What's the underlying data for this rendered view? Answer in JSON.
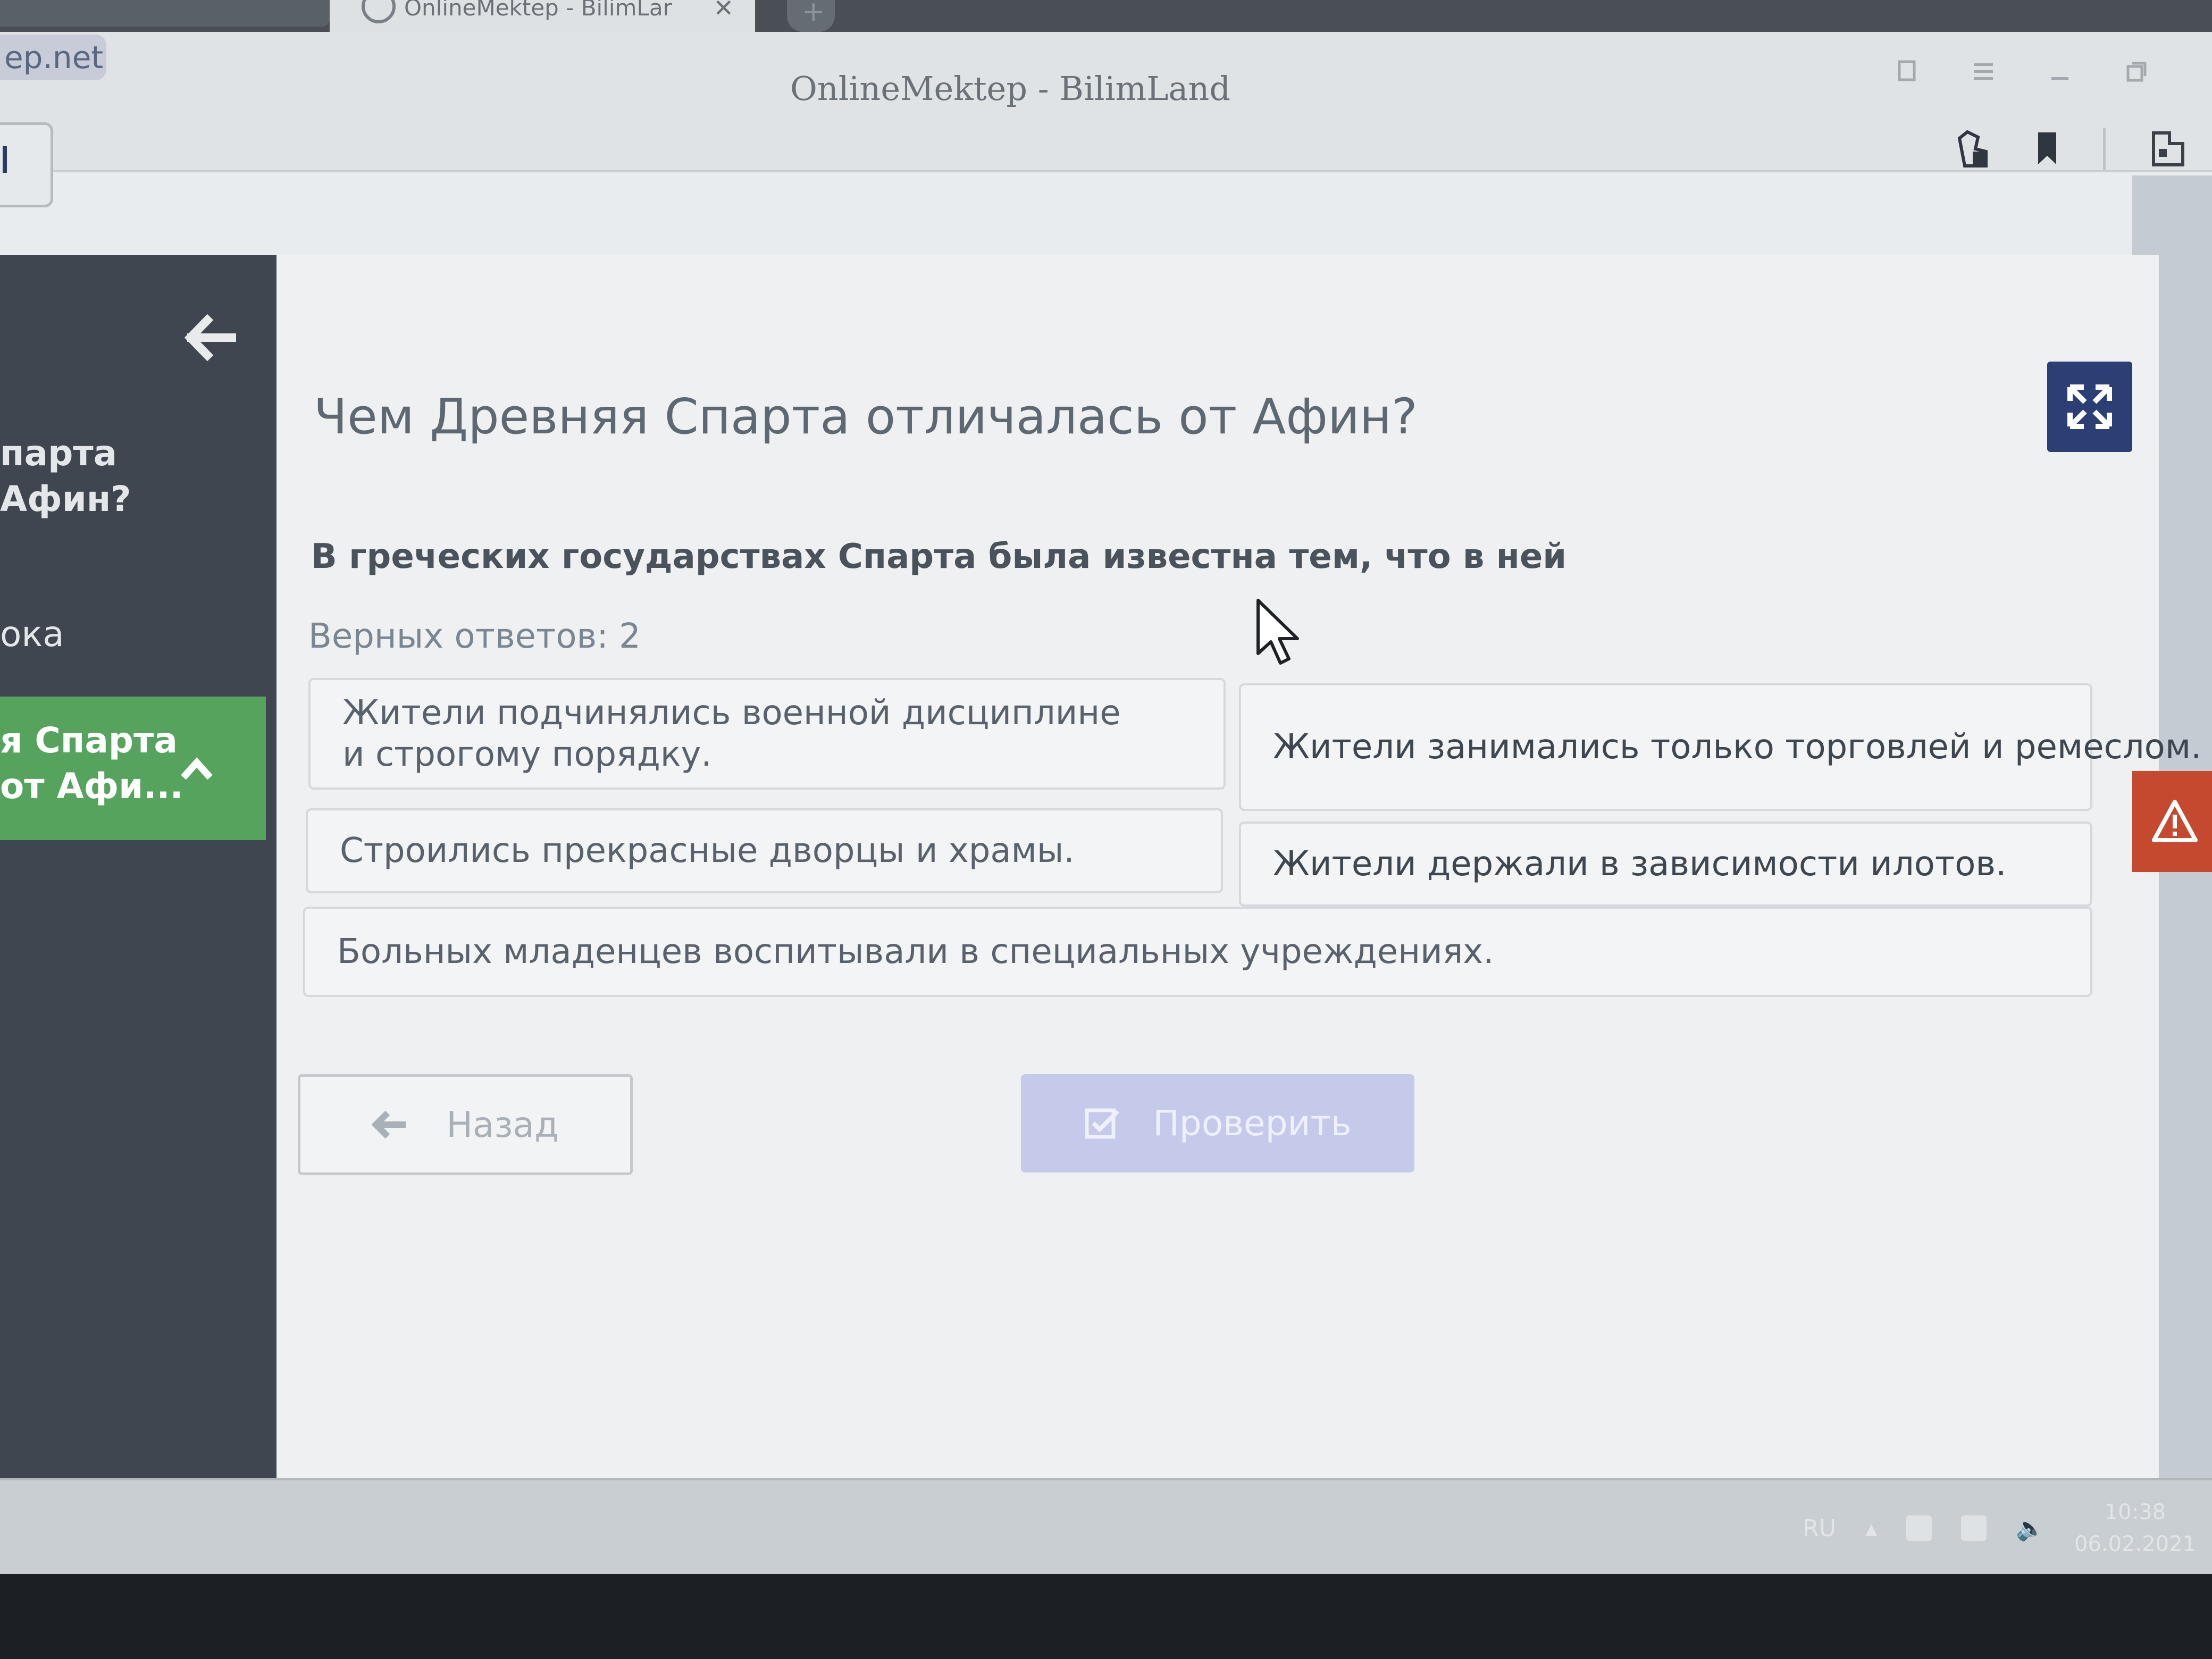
{
  "browser": {
    "tab_title": "OnlineMektep - BilimLar",
    "tab_close": "✕",
    "new_tab": "+",
    "url_fragment": "ep.net",
    "window_title": "OnlineMektep - BilimLand"
  },
  "sidebar": {
    "items": [
      {
        "line1": "парта",
        "line2": "Афин?"
      },
      {
        "line1": "ока"
      },
      {
        "line1": "я Спарта",
        "line2": "от Афи..."
      }
    ]
  },
  "quiz": {
    "title": "Чем Древняя Спарта отличалась от Афин?",
    "question": "В греческих государствах Спарта была известна тем, что в ней",
    "correct_count": "Верных ответов: 2",
    "options": [
      {
        "text": "Жители подчинялись военной дисциплине и строгому порядку."
      },
      {
        "text": "Жители занимались только торговлей и ремеслом."
      },
      {
        "text": "Строились прекрасные дворцы и храмы."
      },
      {
        "text": "Жители держали в зависимости илотов."
      },
      {
        "text": "Больных младенцев воспитывали в специальных учреждениях."
      }
    ],
    "back_label": "Назад",
    "check_label": "Проверить"
  },
  "taskbar": {
    "lang": "RU",
    "time": "10:38",
    "date": "06.02.2021"
  },
  "icons": {
    "back": "arrow-left-icon",
    "collapse": "chevron-up-icon",
    "fullscreen": "fullscreen-icon",
    "report": "warning-icon",
    "check": "checkbox-icon"
  },
  "colors": {
    "sidebar": "#3f464f",
    "active_item": "#55a35d",
    "fullscreen_button": "#2b3f75",
    "report_button": "#c4492f",
    "check_button_disabled": "#c5c9ea"
  }
}
